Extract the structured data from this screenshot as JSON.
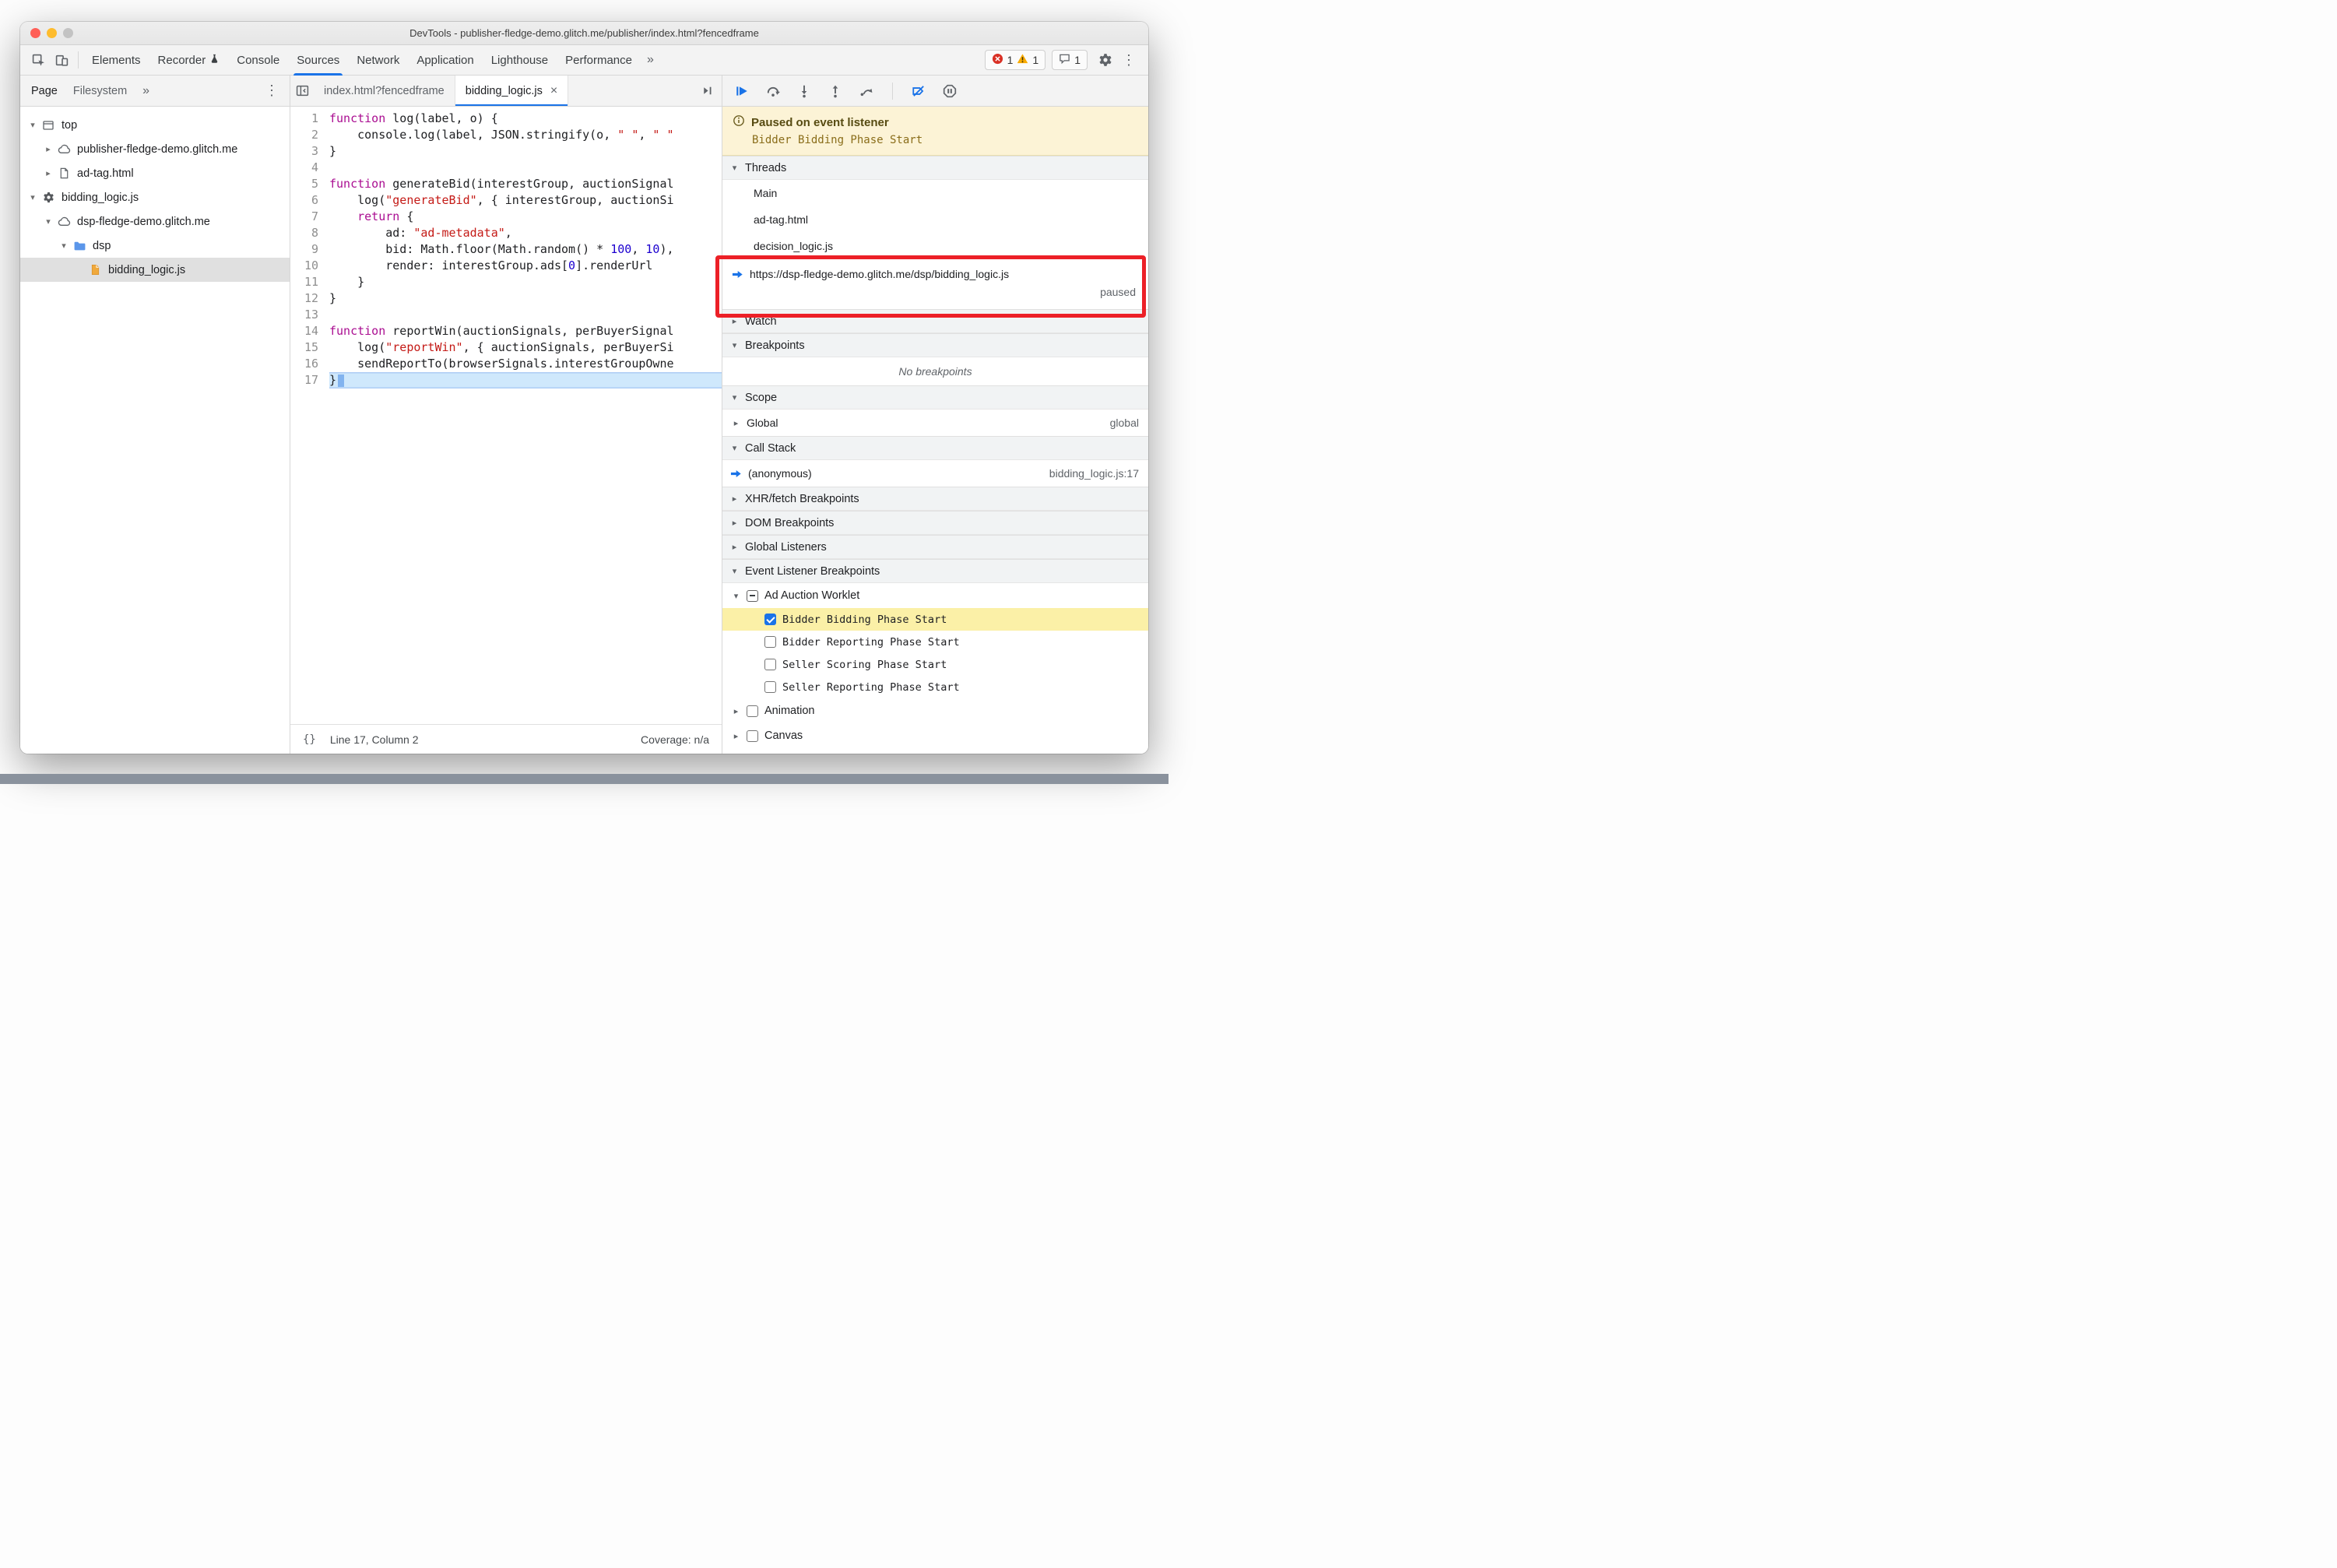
{
  "window": {
    "title": "DevTools - publisher-fledge-demo.glitch.me/publisher/index.html?fencedframe"
  },
  "colors": {
    "accent": "#1a73e8",
    "error": "#d93025",
    "warning": "#f9ab00",
    "annotation": "#ec2027",
    "paused_banner_bg": "#fcf3d6",
    "event_highlight_bg": "#fbf0a7"
  },
  "icons": {
    "overflow": "»",
    "kebab": "⋮",
    "close": "×",
    "expanded": "▾",
    "collapsed": "▸",
    "braces": "{}"
  },
  "toolbar": {
    "tabs": [
      {
        "label": "Elements"
      },
      {
        "label": "Recorder",
        "flask": true
      },
      {
        "label": "Console"
      },
      {
        "label": "Sources",
        "active": true
      },
      {
        "label": "Network"
      },
      {
        "label": "Application"
      },
      {
        "label": "Lighthouse"
      },
      {
        "label": "Performance"
      }
    ],
    "error_count": "1",
    "warning_count": "1",
    "issue_count": "1"
  },
  "sidebar": {
    "tabs": [
      {
        "label": "Page",
        "active": true
      },
      {
        "label": "Filesystem"
      }
    ],
    "tree": [
      {
        "label": "top",
        "icon": "frame-icon",
        "arrow": "down",
        "level": 0
      },
      {
        "label": "publisher-fledge-demo.glitch.me",
        "icon": "cloud-icon",
        "arrow": "right",
        "level": 1
      },
      {
        "label": "ad-tag.html",
        "icon": "document-icon",
        "arrow": "right",
        "level": 1
      },
      {
        "label": "bidding_logic.js",
        "icon": "worklet-gear-icon",
        "arrow": "down",
        "level": 0
      },
      {
        "label": "dsp-fledge-demo.glitch.me",
        "icon": "cloud-icon",
        "arrow": "down",
        "level": 1
      },
      {
        "label": "dsp",
        "icon": "folder-icon",
        "arrow": "down",
        "level": 2
      },
      {
        "label": "bidding_logic.js",
        "icon": "js-file-icon",
        "arrow": "none",
        "level": 3,
        "selected": true
      }
    ]
  },
  "editor": {
    "tabs": [
      {
        "label": "index.html?fencedframe"
      },
      {
        "label": "bidding_logic.js",
        "active": true,
        "closable": true
      }
    ],
    "code_lines": [
      {
        "tokens": [
          [
            "function",
            "kw"
          ],
          [
            " log(label, o) {",
            "pl"
          ]
        ]
      },
      {
        "tokens": [
          [
            "    console.log(label, JSON.stringify(o, ",
            "pl"
          ],
          [
            "\" \"",
            "str"
          ],
          [
            ", ",
            "pl"
          ],
          [
            "\" \"",
            "str"
          ]
        ]
      },
      {
        "tokens": [
          [
            "}",
            "pl"
          ]
        ]
      },
      {
        "tokens": []
      },
      {
        "tokens": [
          [
            "function",
            "kw"
          ],
          [
            " generateBid(interestGroup, auctionSignal",
            "pl"
          ]
        ]
      },
      {
        "tokens": [
          [
            "    log(",
            "pl"
          ],
          [
            "\"generateBid\"",
            "str"
          ],
          [
            ", { interestGroup, auctionSi",
            "pl"
          ]
        ]
      },
      {
        "tokens": [
          [
            "    ",
            "pl"
          ],
          [
            "return",
            "kw"
          ],
          [
            " {",
            "pl"
          ]
        ]
      },
      {
        "tokens": [
          [
            "        ad: ",
            "pl"
          ],
          [
            "\"ad-metadata\"",
            "str"
          ],
          [
            ",",
            "pl"
          ]
        ]
      },
      {
        "tokens": [
          [
            "        bid: Math.floor(Math.random() * ",
            "pl"
          ],
          [
            "100",
            "num"
          ],
          [
            ", ",
            "pl"
          ],
          [
            "10",
            "num"
          ],
          [
            "),",
            "pl"
          ]
        ]
      },
      {
        "tokens": [
          [
            "        render: interestGroup.ads[",
            "pl"
          ],
          [
            "0",
            "num"
          ],
          [
            "].renderUrl",
            "pl"
          ]
        ]
      },
      {
        "tokens": [
          [
            "    }",
            "pl"
          ]
        ]
      },
      {
        "tokens": [
          [
            "}",
            "pl"
          ]
        ]
      },
      {
        "tokens": []
      },
      {
        "tokens": [
          [
            "function",
            "kw"
          ],
          [
            " reportWin(auctionSignals, perBuyerSignal",
            "pl"
          ]
        ]
      },
      {
        "tokens": [
          [
            "    log(",
            "pl"
          ],
          [
            "\"reportWin\"",
            "str"
          ],
          [
            ", { auctionSignals, perBuyerSi",
            "pl"
          ]
        ]
      },
      {
        "tokens": [
          [
            "    sendReportTo(browserSignals.interestGroupOwne",
            "pl"
          ]
        ]
      },
      {
        "tokens": [
          [
            "}",
            "pl"
          ]
        ],
        "highlight": true,
        "cursor": true
      }
    ],
    "status": {
      "position": "Line 17, Column 2",
      "coverage": "Coverage: n/a"
    }
  },
  "debugger": {
    "banner": {
      "title": "Paused on event listener",
      "event": "Bidder Bidding Phase Start"
    },
    "threads": {
      "title": "Threads",
      "items": [
        {
          "label": "Main"
        },
        {
          "label": "ad-tag.html"
        },
        {
          "label": "decision_logic.js"
        },
        {
          "label": "https://dsp-fledge-demo.glitch.me/dsp/bidding_logic.js",
          "active": true,
          "status": "paused"
        }
      ]
    },
    "watch": {
      "title": "Watch"
    },
    "breakpoints": {
      "title": "Breakpoints",
      "empty_text": "No breakpoints"
    },
    "scope": {
      "title": "Scope",
      "rows": [
        {
          "label": "Global",
          "hint": "global"
        }
      ]
    },
    "call_stack": {
      "title": "Call Stack",
      "frames": [
        {
          "name": "(anonymous)",
          "location": "bidding_logic.js:17",
          "active": true
        }
      ]
    },
    "xhr_breakpoints": {
      "title": "XHR/fetch Breakpoints"
    },
    "dom_breakpoints": {
      "title": "DOM Breakpoints"
    },
    "global_listeners": {
      "title": "Global Listeners"
    },
    "event_listener_breakpoints": {
      "title": "Event Listener Breakpoints",
      "items": [
        {
          "label": "Ad Auction Worklet",
          "arrow": "down",
          "checkbox": "indeterminate",
          "level": 0
        },
        {
          "label": "Bidder Bidding Phase Start",
          "checkbox": "checked",
          "level": 1,
          "highlight": true
        },
        {
          "label": "Bidder Reporting Phase Start",
          "checkbox": "unchecked",
          "level": 1
        },
        {
          "label": "Seller Scoring Phase Start",
          "checkbox": "unchecked",
          "level": 1
        },
        {
          "label": "Seller Reporting Phase Start",
          "checkbox": "unchecked",
          "level": 1
        },
        {
          "label": "Animation",
          "arrow": "right",
          "checkbox": "unchecked",
          "level": 0
        },
        {
          "label": "Canvas",
          "arrow": "right",
          "checkbox": "unchecked",
          "level": 0
        }
      ]
    }
  }
}
